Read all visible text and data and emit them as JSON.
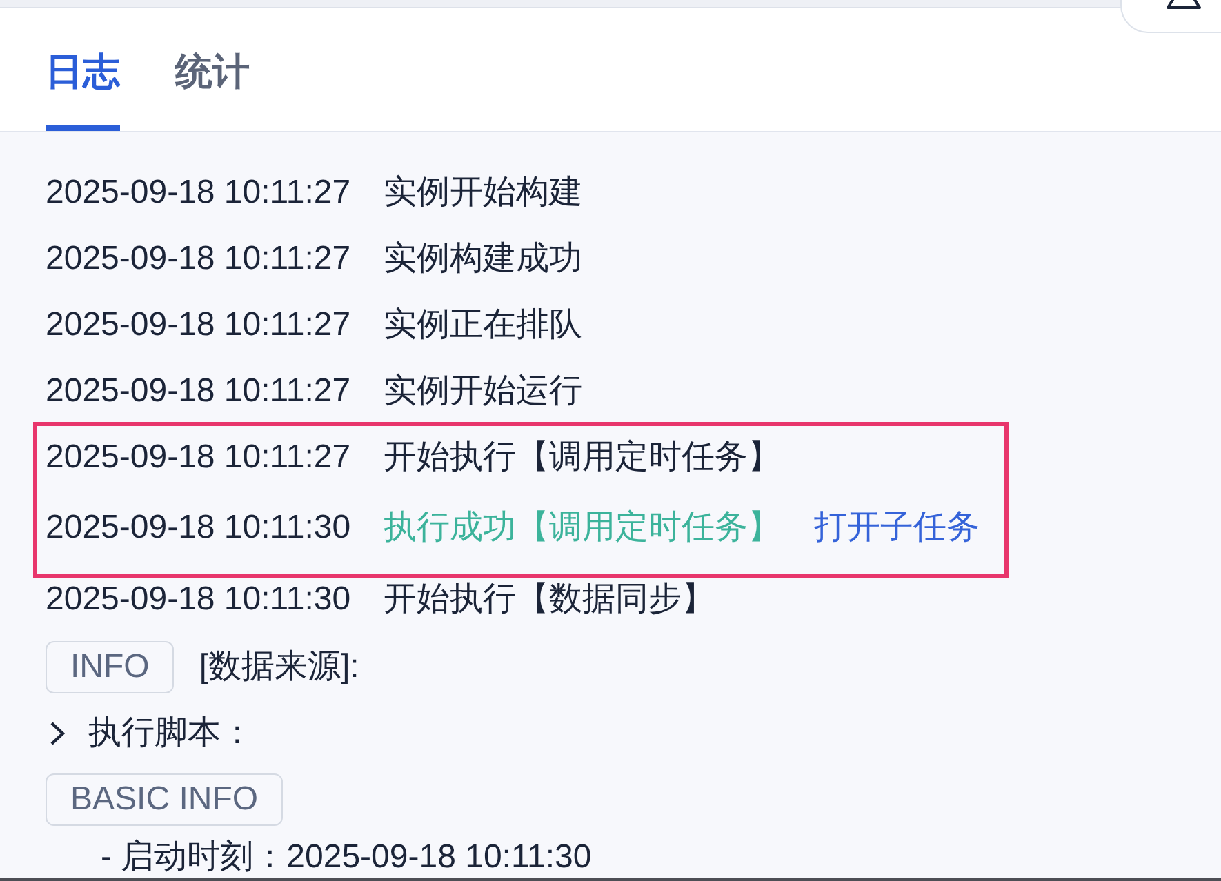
{
  "tabs": [
    {
      "label": "日志",
      "selected": true
    },
    {
      "label": "统计",
      "selected": false
    }
  ],
  "log": [
    {
      "kind": "event",
      "time": "2025-09-18 10:11:27",
      "message": "实例开始构建",
      "succeeded": false,
      "highlighted": false
    },
    {
      "kind": "event",
      "time": "2025-09-18 10:11:27",
      "message": "实例构建成功",
      "succeeded": false,
      "highlighted": false
    },
    {
      "kind": "event",
      "time": "2025-09-18 10:11:27",
      "message": "实例正在排队",
      "succeeded": false,
      "highlighted": false
    },
    {
      "kind": "event",
      "time": "2025-09-18 10:11:27",
      "message": "实例开始运行",
      "succeeded": false,
      "highlighted": false
    },
    {
      "kind": "event",
      "time": "2025-09-18 10:11:27",
      "message": "开始执行【调用定时任务】",
      "succeeded": false,
      "highlighted": true
    },
    {
      "kind": "event",
      "time": "2025-09-18 10:11:30",
      "message": "执行成功【调用定时任务】",
      "succeeded": true,
      "link": "打开子任务",
      "highlighted": true
    },
    {
      "kind": "event",
      "time": "2025-09-18 10:11:30",
      "message": "开始执行【数据同步】",
      "succeeded": false,
      "highlighted": false
    },
    {
      "kind": "tagged",
      "tag": "INFO",
      "text": "[数据来源]:",
      "highlighted": false
    },
    {
      "kind": "collapsible",
      "label": "执行脚本：",
      "expanded": false,
      "highlighted": false
    },
    {
      "kind": "tag",
      "tag": "BASIC INFO",
      "highlighted": false,
      "children": [
        {
          "kind": "detail",
          "text": "- 启动时刻：2025-09-18 10:11:30"
        }
      ]
    }
  ]
}
